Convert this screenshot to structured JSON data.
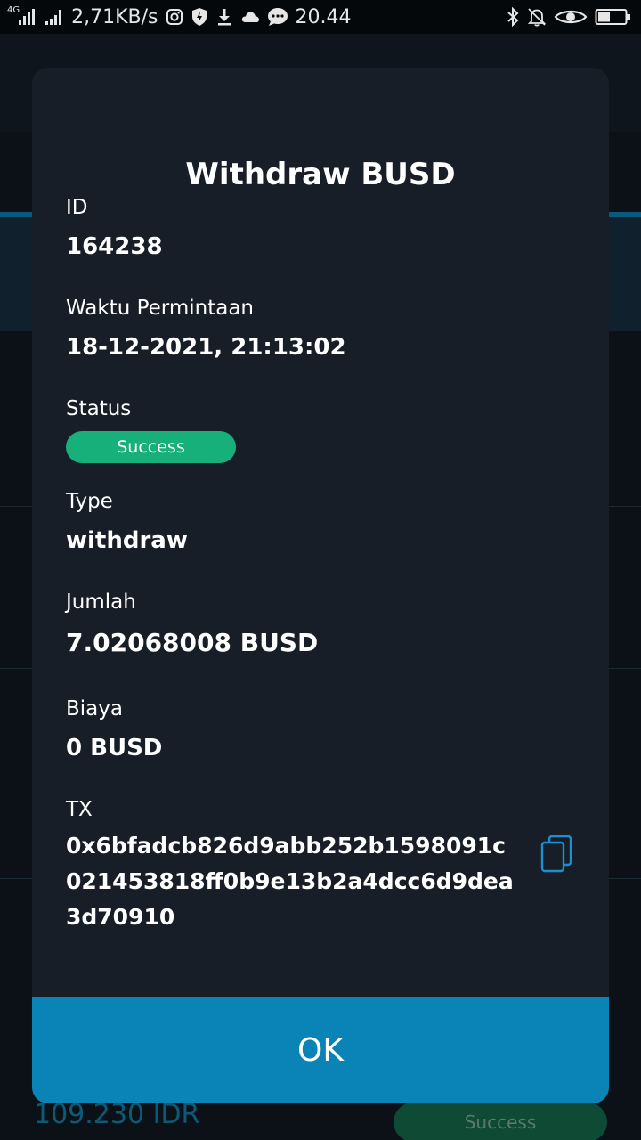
{
  "status_bar": {
    "network_label": "4G",
    "speed": "2,71KB/s",
    "time": "20.44",
    "icons_left": [
      "signal-icon",
      "signal-weak-icon",
      "instagram-icon",
      "shield-bolt-icon",
      "download-icon",
      "cloud-icon",
      "chat-bubble-icon"
    ],
    "icons_right": [
      "bluetooth-icon",
      "bell-off-icon",
      "eye-icon",
      "battery-icon"
    ]
  },
  "background": {
    "amount": "109.230 IDR",
    "badge": "Success"
  },
  "modal": {
    "title": "Withdraw BUSD",
    "fields": {
      "id": {
        "label": "ID",
        "value": "164238"
      },
      "request_time": {
        "label": "Waktu Permintaan",
        "value": "18-12-2021, 21:13:02"
      },
      "status": {
        "label": "Status",
        "value": "Success"
      },
      "type": {
        "label": "Type",
        "value": "withdraw"
      },
      "amount": {
        "label": "Jumlah",
        "value": "7.02068008 BUSD"
      },
      "fee": {
        "label": "Biaya",
        "value": "0 BUSD"
      },
      "tx": {
        "label": "TX",
        "line1": "0x6bfadcb826d9abb252b1598091c",
        "line2": "021453818ff0b9e13b2a4dcc6d9dea",
        "line3": "3d70910"
      }
    },
    "ok_label": "OK"
  },
  "colors": {
    "modal_bg": "#171e27",
    "success": "#17b07b",
    "ok_button": "#0a83b6",
    "copy_icon": "#1a8fd1"
  }
}
